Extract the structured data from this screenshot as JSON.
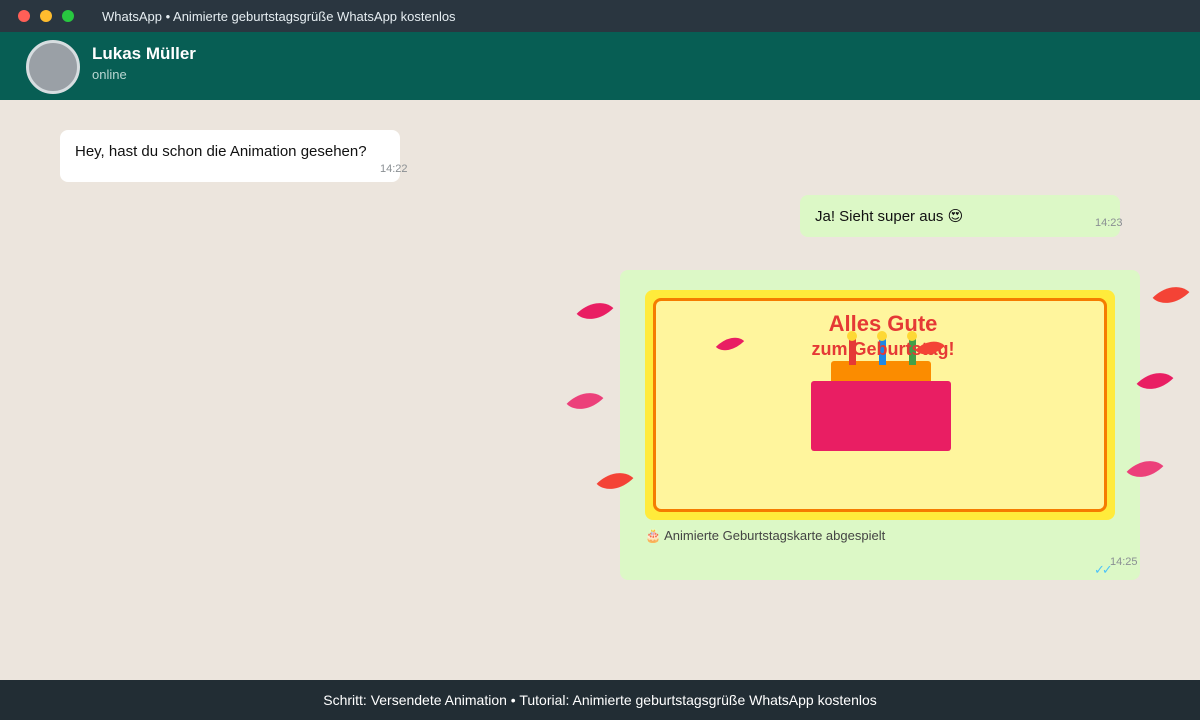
{
  "window": {
    "title": "WhatsApp • Animierte geburtstagsgrüße WhatsApp kostenlos"
  },
  "header": {
    "contact_name": "Lukas Müller",
    "status": "online"
  },
  "messages": [
    {
      "direction": "in",
      "text": "Hey, hast du schon die Animation gesehen?",
      "time": "14:22"
    },
    {
      "direction": "out",
      "text": "Ja! Sieht super aus 😍",
      "time": "14:23"
    }
  ],
  "card": {
    "title": "Alles Gute",
    "subtitle": "zum Geburtstag!",
    "caption": "🎂 Animierte Geburtstagskarte abgespielt",
    "time": "14:25",
    "ticks": "✓✓",
    "colors": {
      "frame": "#ffeb3b",
      "background": "#fff59d",
      "border": "#f57c00",
      "text": "#e53935",
      "cake_base": "#e91e63",
      "cake_top": "#fb8c00"
    }
  },
  "footer": {
    "text": "Schritt: Versendete Animation • Tutorial: Animierte geburtstagsgrüße WhatsApp kostenlos"
  },
  "colors": {
    "titlebar": "#2a3640",
    "header": "#075e54",
    "chat_bg": "#ece5dd",
    "bubble_out": "#dcf8c6",
    "bubble_in": "#ffffff",
    "footer": "#222d34",
    "read_ticks": "#4fc3f7"
  }
}
